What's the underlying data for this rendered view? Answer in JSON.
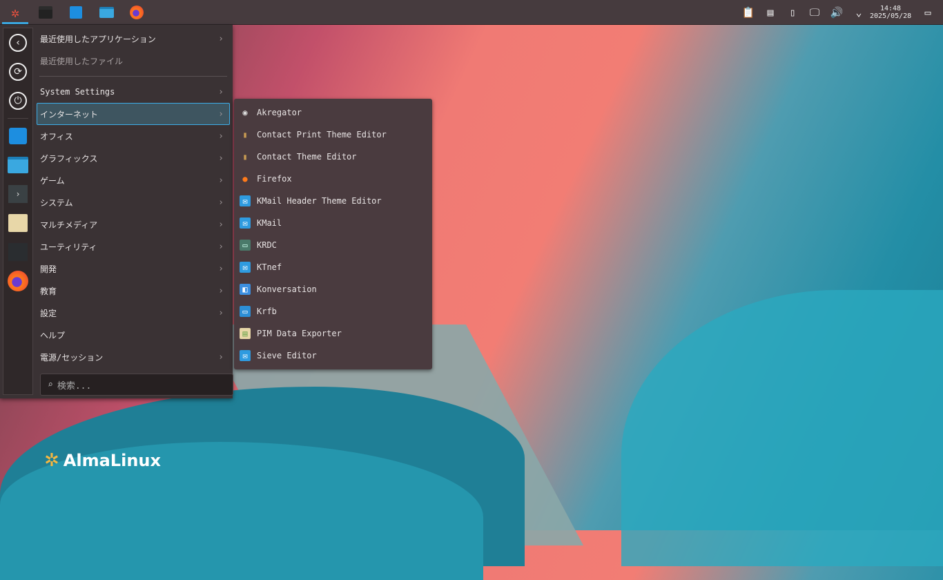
{
  "taskbar": {
    "apps": [
      "application-launcher",
      "system-settings",
      "discover",
      "dolphin",
      "firefox"
    ],
    "tray": {
      "time": "14:48",
      "date": "2025/05/28"
    }
  },
  "menu": {
    "items": [
      {
        "label": "最近使用したアプリケーション",
        "arrow": true
      },
      {
        "label": "最近使用したファイル",
        "arrow": false,
        "dim": true
      },
      {
        "label": "System Settings",
        "arrow": true
      },
      {
        "label": "インターネット",
        "arrow": true,
        "selected": true
      },
      {
        "label": "オフィス",
        "arrow": true
      },
      {
        "label": "グラフィックス",
        "arrow": true
      },
      {
        "label": "ゲーム",
        "arrow": true
      },
      {
        "label": "システム",
        "arrow": true
      },
      {
        "label": "マルチメディア",
        "arrow": true
      },
      {
        "label": "ユーティリティ",
        "arrow": true
      },
      {
        "label": "開発",
        "arrow": true
      },
      {
        "label": "教育",
        "arrow": true
      },
      {
        "label": "設定",
        "arrow": true
      },
      {
        "label": "ヘルプ",
        "arrow": false
      },
      {
        "label": "電源/セッション",
        "arrow": true
      }
    ],
    "search_placeholder": "検索..."
  },
  "submenu": {
    "items": [
      {
        "label": "Akregator",
        "icon": "rss-icon"
      },
      {
        "label": "Contact Print Theme Editor",
        "icon": "addressbook-icon"
      },
      {
        "label": "Contact Theme Editor",
        "icon": "addressbook-icon"
      },
      {
        "label": "Firefox",
        "icon": "firefox-icon"
      },
      {
        "label": "KMail Header Theme Editor",
        "icon": "mail-icon"
      },
      {
        "label": "KMail",
        "icon": "mail-icon"
      },
      {
        "label": "KRDC",
        "icon": "remote-desktop-icon"
      },
      {
        "label": "KTnef",
        "icon": "mail-icon"
      },
      {
        "label": "Konversation",
        "icon": "chat-icon"
      },
      {
        "label": "Krfb",
        "icon": "desktop-share-icon"
      },
      {
        "label": "PIM Data Exporter",
        "icon": "archive-icon"
      },
      {
        "label": "Sieve Editor",
        "icon": "mail-icon"
      }
    ]
  },
  "desktop": {
    "logo_text": "AlmaLinux"
  }
}
